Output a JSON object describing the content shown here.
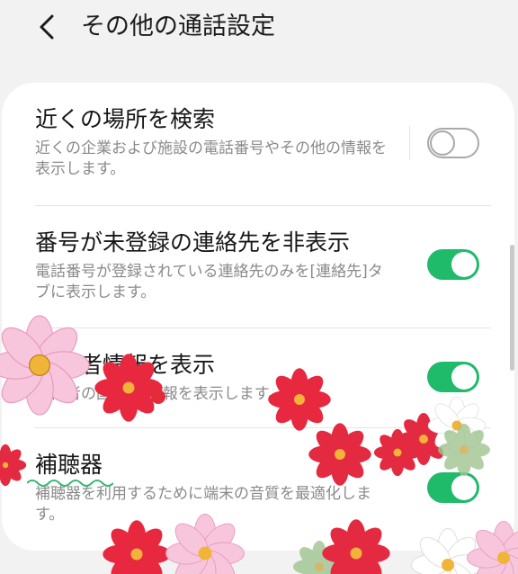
{
  "header": {
    "title": "その他の通話設定"
  },
  "settings": [
    {
      "label": "近くの場所を検索",
      "description": "近くの企業および施設の電話番号やその他の情報を表示します。",
      "enabled": false
    },
    {
      "label": "番号が未登録の連絡先を非表示",
      "description": "電話番号が登録されている連絡先のみを[連絡先]タブに表示します。",
      "enabled": true
    },
    {
      "label": "発信者情報を表示",
      "description": "発信者の国/地域情報を表示します。",
      "enabled": true
    },
    {
      "label": "補聴器",
      "description": "補聴器を利用するために端末の音質を最適化します。",
      "enabled": true
    }
  ],
  "colors": {
    "accent": "#1fba6a",
    "background": "#f2f2f2",
    "card": "#ffffff",
    "secondary_text": "#8a8a8a"
  },
  "icons": {
    "back": "chevron-left-icon"
  }
}
